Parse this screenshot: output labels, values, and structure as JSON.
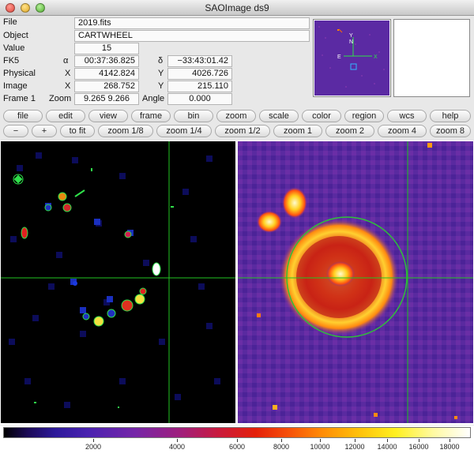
{
  "window": {
    "title": "SAOImage ds9"
  },
  "info": {
    "file_label": "File",
    "file_value": "2019.fits",
    "object_label": "Object",
    "object_value": "CARTWHEEL",
    "value_label": "Value",
    "value_value": "15",
    "fk5_label": "FK5",
    "alpha_symbol": "α",
    "alpha_value": "00:37:36.825",
    "delta_symbol": "δ",
    "delta_value": "−33:43:01.42",
    "physical_label": "Physical",
    "physical_x_label": "X",
    "physical_x": "4142.824",
    "physical_y_label": "Y",
    "physical_y": "4026.726",
    "image_label": "Image",
    "image_x_label": "X",
    "image_x": "268.752",
    "image_y_label": "Y",
    "image_y": "215.110",
    "frame_label": "Frame 1",
    "zoom_label": "Zoom",
    "zoom_value": "9.265  9.266",
    "angle_label": "Angle",
    "angle_value": "0.000"
  },
  "panner": {
    "compass_n": "N",
    "compass_e": "E",
    "compass_x": "X",
    "compass_y": "Y"
  },
  "menu_buttons": [
    "file",
    "edit",
    "view",
    "frame",
    "bin",
    "zoom",
    "scale",
    "color",
    "region",
    "wcs",
    "help"
  ],
  "zoom_buttons": [
    "−",
    "+",
    "to fit",
    "zoom 1/8",
    "zoom 1/4",
    "zoom 1/2",
    "zoom 1",
    "zoom 2",
    "zoom 4",
    "zoom 8"
  ],
  "colorbar": {
    "ticks": [
      "2000",
      "4000",
      "6000",
      "8000",
      "10000",
      "12000",
      "14000",
      "16000",
      "18000"
    ],
    "colors": {
      "crosshair": "#22c322",
      "region": "#2fbf3a"
    }
  }
}
